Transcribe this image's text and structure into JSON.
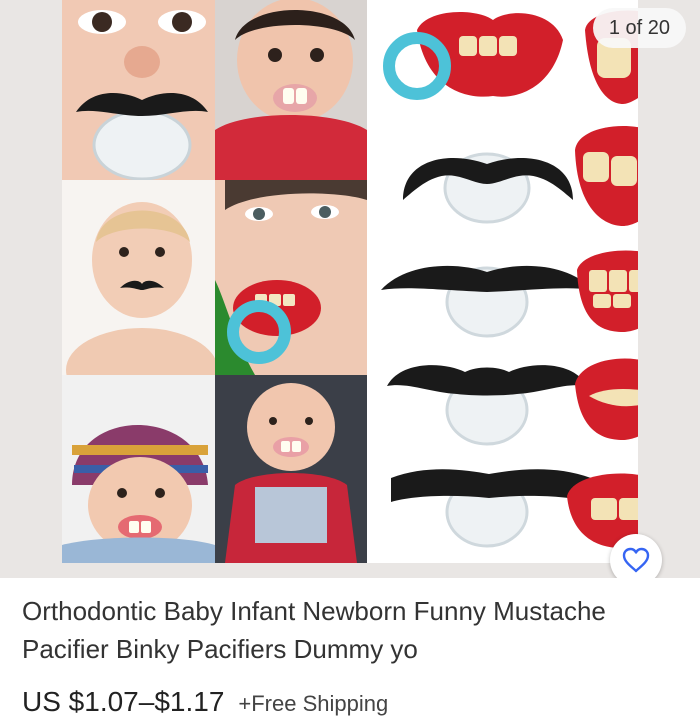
{
  "gallery": {
    "counter": "1 of 20",
    "image_alt": "Baby photos wearing mustache and teeth pacifiers, and product shots of mustache and lips pacifiers"
  },
  "icons": {
    "watch": "heart-icon"
  },
  "colors": {
    "accent": "#3665f3",
    "lips_red": "#d21f2a",
    "mustache_black": "#1a1a1a",
    "ring_blue": "#4dc2d8"
  },
  "listing": {
    "title": "Orthodontic Baby Infant Newborn Funny Mustache Pacifier Binky Pacifiers Dummy yo",
    "price": "US $1.07–$1.17",
    "shipping": "+Free Shipping"
  }
}
